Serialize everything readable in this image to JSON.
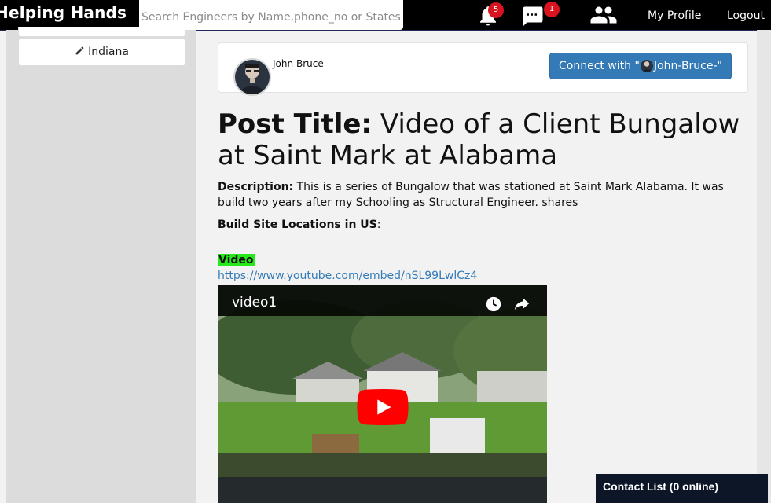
{
  "nav": {
    "brand": "Helping Hands",
    "search_placeholder": "Search Engineers by Name,phone_no or States",
    "notifications_count": "5",
    "messages_count": "1",
    "my_profile": "My Profile",
    "logout": "Logout"
  },
  "sidebar": {
    "state_label": "Indiana"
  },
  "author": {
    "name": "John-Bruce-",
    "connect_prefix": "Connect with \"",
    "connect_name": "John-Bruce-\""
  },
  "post": {
    "title_label": "Post Title:",
    "title_text": "Video of a Client Bungalow at Saint Mark at Alabama",
    "description_label": "Description:",
    "description_text": "This is a series of Bungalow that was stationed at Saint Mark Alabama. It was build two years after my Schooling as Structural Engineer. shares",
    "build_label": "Build Site Locations in US",
    "build_colon": ":",
    "video_label": "Video",
    "video_url": "https://www.youtube.com/embed/nSL99LwlCz4",
    "video_title": "video1"
  },
  "contact_list": "Contact List (0 online)",
  "colors": {
    "accent": "#337ab7",
    "badge": "#d9131f",
    "video_highlight": "#27e81a",
    "contact_bg": "#0c1627"
  }
}
